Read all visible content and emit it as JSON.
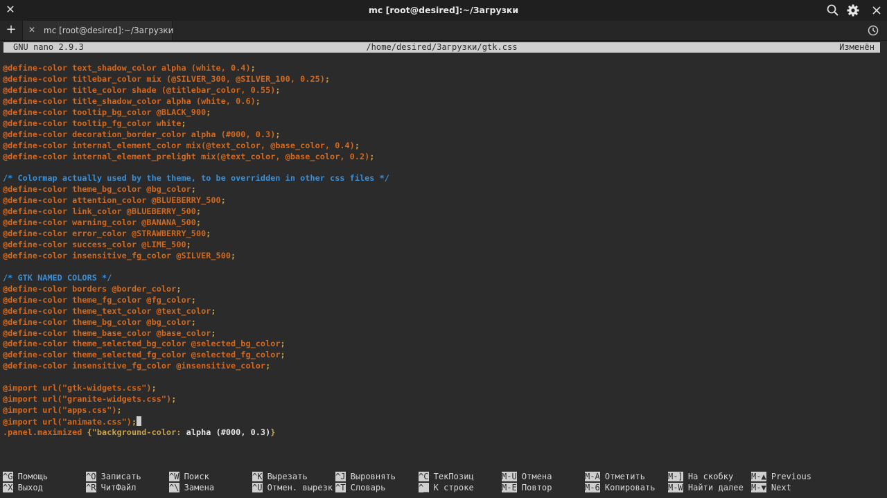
{
  "window": {
    "title": "mc [root@desired]:~/Загрузки",
    "icons": [
      "close-icon",
      "search-icon",
      "gear-icon",
      "close-window-icon"
    ]
  },
  "tabs": [
    {
      "label": "mc [root@desired]:~/Загрузки"
    }
  ],
  "nano": {
    "version": "GNU nano 2.9.3",
    "file": "/home/desired/Загрузки/gtk.css",
    "status": "Изменён"
  },
  "code": [
    {
      "t": "@define-color text_shadow_color alpha (white, 0.4);"
    },
    {
      "t": "@define-color titlebar_color mix (@SILVER_300, @SILVER_100, 0.25);"
    },
    {
      "t": "@define-color title_color shade (@titlebar_color, 0.55);"
    },
    {
      "t": "@define-color title_shadow_color alpha (white, 0.6);"
    },
    {
      "t": "@define-color tooltip_bg_color @BLACK_900;"
    },
    {
      "t": "@define-color tooltip_fg_color white;"
    },
    {
      "t": "@define-color decoration_border_color alpha (#000, 0.3);"
    },
    {
      "t": "@define-color internal_element_color mix(@text_color, @base_color, 0.4);"
    },
    {
      "t": "@define-color internal_element_prelight mix(@text_color, @base_color, 0.2);"
    },
    {
      "t": ""
    },
    {
      "t": "/* Colormap actually used by the theme, to be overridden in other css files */"
    },
    {
      "t": "@define-color theme_bg_color @bg_color;"
    },
    {
      "t": "@define-color attention_color @BLUEBERRY_500;"
    },
    {
      "t": "@define-color link_color @BLUEBERRY_500;"
    },
    {
      "t": "@define-color warning_color @BANANA_500;"
    },
    {
      "t": "@define-color error_color @STRAWBERRY_500;"
    },
    {
      "t": "@define-color success_color @LIME_500;"
    },
    {
      "t": "@define-color insensitive_fg_color @SILVER_500;"
    },
    {
      "t": ""
    },
    {
      "t": "/* GTK NAMED COLORS */"
    },
    {
      "t": "@define-color borders @border_color;"
    },
    {
      "t": "@define-color theme_fg_color @fg_color;"
    },
    {
      "t": "@define-color theme_text_color @text_color;"
    },
    {
      "t": "@define-color theme_bg_color @bg_color;"
    },
    {
      "t": "@define-color theme_base_color @base_color;"
    },
    {
      "t": "@define-color theme_selected_bg_color @selected_bg_color;"
    },
    {
      "t": "@define-color theme_selected_fg_color @selected_fg_color;"
    },
    {
      "t": "@define-color insensitive_fg_color @insensitive_color;"
    },
    {
      "t": ""
    },
    {
      "t": "@import url(\"gtk-widgets.css\");"
    },
    {
      "t": "@import url(\"granite-widgets.css\");"
    },
    {
      "t": "@import url(\"apps.css\");"
    },
    {
      "t": "@import url(\"animate.css\");"
    },
    {
      "t": ".panel.maximized {\"background-color: alpha (#000, 0.3)}"
    }
  ],
  "shortcuts_row1": [
    {
      "key": "^G",
      "label": "Помощь"
    },
    {
      "key": "^O",
      "label": "Записать"
    },
    {
      "key": "^W",
      "label": "Поиск"
    },
    {
      "key": "^K",
      "label": "Вырезать"
    },
    {
      "key": "^J",
      "label": "Выровнять"
    },
    {
      "key": "^C",
      "label": "ТекПозиц"
    },
    {
      "key": "M-U",
      "label": "Отмена"
    },
    {
      "key": "M-A",
      "label": "Отметить"
    },
    {
      "key": "M-]",
      "label": "На скобку"
    },
    {
      "key": "M-▲",
      "label": "Previous"
    }
  ],
  "shortcuts_row2": [
    {
      "key": "^X",
      "label": "Выход"
    },
    {
      "key": "^R",
      "label": "ЧитФайл"
    },
    {
      "key": "^\\",
      "label": "Замена"
    },
    {
      "key": "^U",
      "label": "Отмен. вырезк"
    },
    {
      "key": "^T",
      "label": "Словарь"
    },
    {
      "key": "^_",
      "label": "К строке"
    },
    {
      "key": "M-E",
      "label": "Повтор"
    },
    {
      "key": "M-6",
      "label": "Копировать"
    },
    {
      "key": "M-W",
      "label": "Найти далее"
    },
    {
      "key": "M-▼",
      "label": "Next"
    }
  ]
}
